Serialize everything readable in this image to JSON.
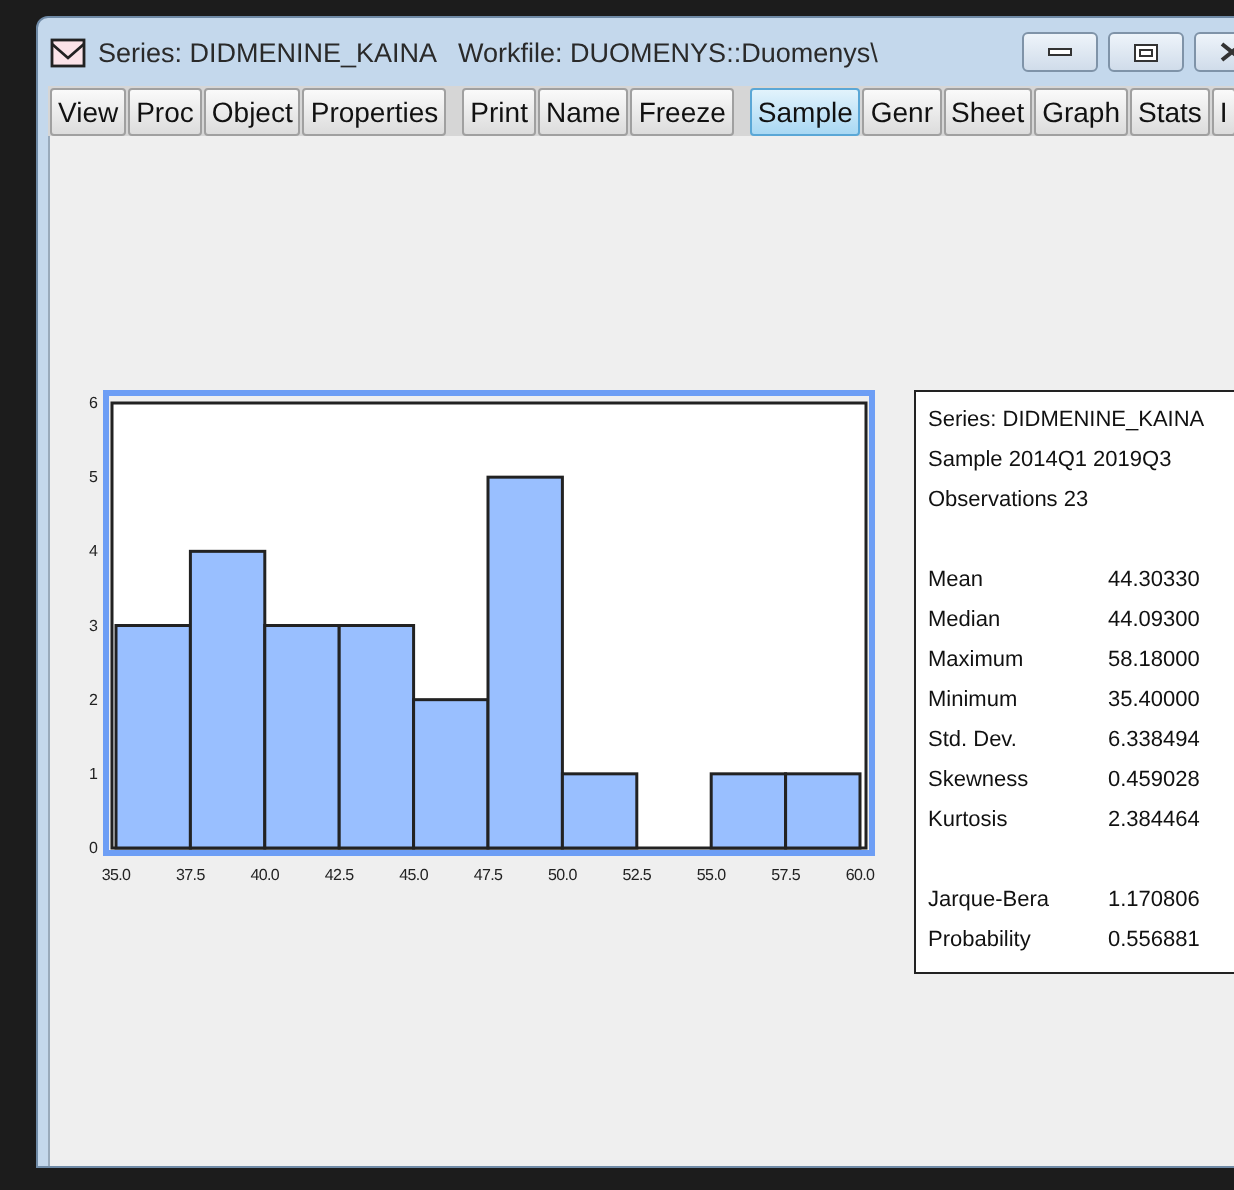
{
  "window": {
    "title": "Series: DIDMENINE_KAINA   Workfile: DUOMENYS::Duomenys\\"
  },
  "toolbar_groups": [
    {
      "buttons": [
        {
          "label": "View",
          "selected": false
        },
        {
          "label": "Proc",
          "selected": false
        },
        {
          "label": "Object",
          "selected": false
        },
        {
          "label": "Properties",
          "selected": false
        }
      ]
    },
    {
      "buttons": [
        {
          "label": "Print",
          "selected": false
        },
        {
          "label": "Name",
          "selected": false
        },
        {
          "label": "Freeze",
          "selected": false
        }
      ]
    },
    {
      "buttons": [
        {
          "label": "Sample",
          "selected": true
        },
        {
          "label": "Genr",
          "selected": false
        },
        {
          "label": "Sheet",
          "selected": false
        },
        {
          "label": "Graph",
          "selected": false
        },
        {
          "label": "Stats",
          "selected": false
        },
        {
          "label": "I",
          "selected": false
        }
      ]
    }
  ],
  "histogram": {
    "chart_data": {
      "type": "bar",
      "x": [
        36.25,
        38.75,
        41.25,
        43.75,
        46.25,
        48.75,
        51.25,
        53.75,
        56.25,
        58.75
      ],
      "values": [
        3,
        4,
        3,
        3,
        2,
        5,
        1,
        0,
        1,
        1
      ],
      "xlim": [
        35,
        60
      ],
      "ylim": [
        0,
        6
      ],
      "xticks": [
        {
          "value": 35,
          "label": "35.0"
        },
        {
          "value": 37.5,
          "label": "37.5"
        },
        {
          "value": 40,
          "label": "40.0"
        },
        {
          "value": 42.5,
          "label": "42.5"
        },
        {
          "value": 45,
          "label": "45.0"
        },
        {
          "value": 47.5,
          "label": "47.5"
        },
        {
          "value": 50,
          "label": "50.0"
        },
        {
          "value": 52.5,
          "label": "52.5"
        },
        {
          "value": 55,
          "label": "55.0"
        },
        {
          "value": 57.5,
          "label": "57.5"
        },
        {
          "value": 60,
          "label": "60.0"
        }
      ],
      "yticks": [
        0,
        1,
        2,
        3,
        4,
        5,
        6
      ]
    }
  },
  "statistics": {
    "header": [
      "Series: DIDMENINE_KAINA",
      "Sample 2014Q1 2019Q3",
      "Observations 23"
    ],
    "rows": [
      {
        "label": "Mean",
        "value": "44.30330"
      },
      {
        "label": "Median",
        "value": "44.09300"
      },
      {
        "label": "Maximum",
        "value": "58.18000"
      },
      {
        "label": "Minimum",
        "value": "35.40000"
      },
      {
        "label": "Std. Dev.",
        "value": "6.338494"
      },
      {
        "label": "Skewness",
        "value": "0.459028"
      },
      {
        "label": "Kurtosis",
        "value": "2.384464"
      }
    ],
    "tests": [
      {
        "label": "Jarque-Bera",
        "value": "1.170806"
      },
      {
        "label": "Probability",
        "value": "0.556881"
      }
    ]
  }
}
